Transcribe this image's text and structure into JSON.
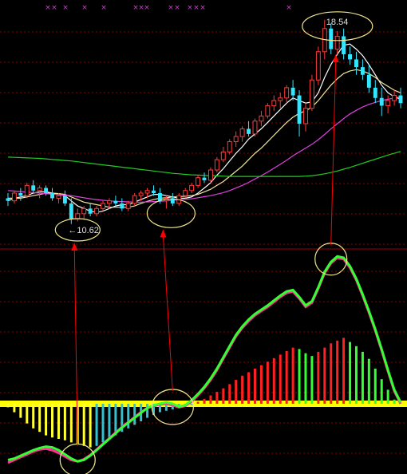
{
  "colors": {
    "background": "#000000",
    "grid": "#8b0000",
    "separator": "#a00000",
    "candle_up": "#ff3b3b",
    "candle_down": "#33e6ff",
    "ma_short": "#ffffff",
    "ma_mid": "#f2e6a0",
    "ma_long": "#e040e0",
    "ma_longest": "#22cc22",
    "macd_pos": "#ff2020",
    "macd_pos_green": "#33ff33",
    "macd_neg_yellow": "#ffff33",
    "macd_neg_cyan": "#33c0d0",
    "zero_band": "#ffff00",
    "dif_line": "#33ff33",
    "dea_line": "#ff3399",
    "circle": "#f0e68c",
    "arrow": "#ff0000",
    "marker_x": "#d040d0"
  },
  "chart_data": [
    {
      "type": "candlestick",
      "annotations": {
        "low_label": "←10.62",
        "high_label": "18.54"
      },
      "grid": true,
      "candles": [
        [
          11.6,
          11.8,
          11.3,
          11.5
        ],
        [
          11.5,
          11.9,
          11.4,
          11.8
        ],
        [
          11.8,
          12.0,
          11.5,
          11.7
        ],
        [
          11.7,
          12.2,
          11.6,
          12.1
        ],
        [
          12.1,
          12.3,
          11.8,
          11.9
        ],
        [
          11.9,
          12.1,
          11.6,
          12.0
        ],
        [
          12.0,
          12.1,
          11.7,
          11.8
        ],
        [
          11.8,
          12.0,
          11.5,
          11.6
        ],
        [
          11.6,
          11.8,
          11.4,
          11.7
        ],
        [
          11.7,
          11.9,
          11.3,
          11.4
        ],
        [
          11.4,
          11.6,
          10.6,
          10.8
        ],
        [
          10.8,
          11.2,
          10.7,
          11.0
        ],
        [
          11.0,
          11.3,
          10.8,
          11.2
        ],
        [
          11.2,
          11.4,
          10.9,
          11.0
        ],
        [
          11.0,
          11.3,
          10.9,
          11.2
        ],
        [
          11.2,
          11.5,
          11.1,
          11.4
        ],
        [
          11.4,
          11.6,
          11.2,
          11.5
        ],
        [
          11.5,
          11.7,
          11.3,
          11.4
        ],
        [
          11.4,
          11.6,
          11.1,
          11.2
        ],
        [
          11.2,
          11.5,
          11.1,
          11.4
        ],
        [
          11.4,
          11.8,
          11.3,
          11.7
        ],
        [
          11.7,
          11.9,
          11.5,
          11.8
        ],
        [
          11.8,
          12.0,
          11.6,
          11.9
        ],
        [
          11.9,
          12.1,
          11.7,
          11.8
        ],
        [
          11.8,
          12.0,
          11.4,
          11.5
        ],
        [
          11.5,
          11.7,
          11.2,
          11.6
        ],
        [
          11.6,
          11.8,
          11.3,
          11.4
        ],
        [
          11.4,
          11.8,
          11.3,
          11.7
        ],
        [
          11.7,
          12.0,
          11.6,
          11.9
        ],
        [
          11.9,
          12.2,
          11.8,
          12.1
        ],
        [
          12.1,
          12.5,
          12.0,
          12.4
        ],
        [
          12.4,
          12.6,
          12.2,
          12.3
        ],
        [
          12.3,
          12.8,
          12.2,
          12.7
        ],
        [
          12.7,
          13.2,
          12.6,
          13.1
        ],
        [
          13.1,
          13.6,
          13.0,
          13.4
        ],
        [
          13.4,
          13.9,
          13.3,
          13.8
        ],
        [
          13.8,
          14.2,
          13.6,
          14.0
        ],
        [
          14.0,
          14.4,
          13.8,
          14.3
        ],
        [
          14.3,
          14.6,
          14.0,
          14.1
        ],
        [
          14.1,
          14.7,
          14.0,
          14.6
        ],
        [
          14.6,
          15.0,
          14.4,
          14.8
        ],
        [
          14.8,
          15.3,
          14.7,
          15.2
        ],
        [
          15.2,
          15.6,
          15.0,
          15.4
        ],
        [
          15.4,
          15.7,
          15.1,
          15.5
        ],
        [
          15.5,
          16.0,
          15.3,
          15.9
        ],
        [
          15.9,
          16.2,
          15.4,
          15.6
        ],
        [
          15.6,
          15.8,
          14.0,
          14.5
        ],
        [
          14.5,
          15.3,
          14.2,
          15.1
        ],
        [
          15.1,
          16.4,
          15.0,
          16.2
        ],
        [
          16.2,
          17.5,
          16.0,
          17.3
        ],
        [
          17.3,
          18.54,
          17.0,
          18.2
        ],
        [
          18.2,
          18.4,
          17.2,
          17.4
        ],
        [
          17.4,
          18.1,
          17.2,
          17.9
        ],
        [
          17.9,
          18.2,
          17.0,
          17.2
        ],
        [
          17.2,
          17.5,
          16.8,
          17.0
        ],
        [
          17.0,
          17.3,
          16.4,
          16.7
        ],
        [
          16.7,
          17.0,
          16.2,
          16.4
        ],
        [
          16.4,
          16.8,
          15.7,
          15.9
        ],
        [
          15.9,
          16.2,
          15.3,
          15.5
        ],
        [
          15.5,
          15.9,
          14.8,
          15.2
        ],
        [
          15.2,
          15.6,
          14.9,
          15.4
        ],
        [
          15.4,
          15.8,
          15.2,
          15.6
        ],
        [
          15.6,
          15.9,
          15.1,
          15.3
        ]
      ],
      "ylim": [
        10.0,
        19.0
      ],
      "series": [
        {
          "name": "MA5",
          "values": [
            11.5,
            11.6,
            11.65,
            11.7,
            11.8,
            11.85,
            11.85,
            11.8,
            11.75,
            11.7,
            11.5,
            11.3,
            11.2,
            11.1,
            11.05,
            11.1,
            11.2,
            11.3,
            11.35,
            11.35,
            11.45,
            11.55,
            11.65,
            11.75,
            11.75,
            11.7,
            11.65,
            11.6,
            11.6,
            11.65,
            11.8,
            12.0,
            12.2,
            12.5,
            12.75,
            13.05,
            13.35,
            13.6,
            13.9,
            14.1,
            14.3,
            14.55,
            14.8,
            15.05,
            15.3,
            15.5,
            15.4,
            15.3,
            15.35,
            15.7,
            16.3,
            16.8,
            17.2,
            17.55,
            17.6,
            17.4,
            17.15,
            16.8,
            16.4,
            16.0,
            15.7,
            15.55,
            15.45
          ]
        },
        {
          "name": "MA10",
          "values": [
            11.6,
            11.6,
            11.6,
            11.65,
            11.7,
            11.75,
            11.8,
            11.8,
            11.78,
            11.75,
            11.65,
            11.55,
            11.45,
            11.4,
            11.35,
            11.3,
            11.25,
            11.25,
            11.25,
            11.25,
            11.3,
            11.4,
            11.48,
            11.55,
            11.6,
            11.62,
            11.65,
            11.66,
            11.68,
            11.7,
            11.75,
            11.85,
            11.95,
            12.1,
            12.25,
            12.45,
            12.65,
            12.85,
            13.1,
            13.35,
            13.55,
            13.8,
            14.05,
            14.3,
            14.55,
            14.75,
            14.9,
            15.0,
            15.15,
            15.4,
            15.7,
            16.0,
            16.25,
            16.45,
            16.55,
            16.6,
            16.55,
            16.45,
            16.3,
            16.1,
            15.95,
            15.8,
            15.7
          ]
        },
        {
          "name": "MA30",
          "values": [
            11.9,
            11.88,
            11.86,
            11.84,
            11.82,
            11.8,
            11.78,
            11.76,
            11.74,
            11.72,
            11.7,
            11.66,
            11.62,
            11.58,
            11.55,
            11.52,
            11.5,
            11.48,
            11.47,
            11.46,
            11.45,
            11.45,
            11.46,
            11.47,
            11.48,
            11.5,
            11.52,
            11.54,
            11.56,
            11.58,
            11.62,
            11.66,
            11.7,
            11.76,
            11.82,
            11.9,
            12.0,
            12.1,
            12.22,
            12.35,
            12.48,
            12.62,
            12.77,
            12.92,
            13.08,
            13.25,
            13.4,
            13.55,
            13.7,
            13.88,
            14.08,
            14.3,
            14.5,
            14.7,
            14.88,
            15.02,
            15.15,
            15.25,
            15.33,
            15.4,
            15.45,
            15.5,
            15.55
          ]
        },
        {
          "name": "MA60",
          "values": [
            13.2,
            13.19,
            13.18,
            13.17,
            13.16,
            13.15,
            13.13,
            13.11,
            13.09,
            13.07,
            13.05,
            13.02,
            12.99,
            12.96,
            12.93,
            12.9,
            12.87,
            12.84,
            12.81,
            12.78,
            12.75,
            12.72,
            12.69,
            12.66,
            12.63,
            12.6,
            12.57,
            12.55,
            12.53,
            12.51,
            12.5,
            12.49,
            12.48,
            12.47,
            12.46,
            12.45,
            12.45,
            12.45,
            12.45,
            12.45,
            12.45,
            12.45,
            12.45,
            12.45,
            12.45,
            12.45,
            12.45,
            12.46,
            12.48,
            12.51,
            12.55,
            12.6,
            12.66,
            12.73,
            12.8,
            12.88,
            12.96,
            13.04,
            13.12,
            13.2,
            13.28,
            13.35,
            13.42
          ]
        }
      ]
    },
    {
      "type": "bar",
      "ylim": [
        -1.0,
        2.0
      ],
      "zero_line": true,
      "histogram": [
        -0.05,
        -0.12,
        -0.2,
        -0.28,
        -0.35,
        -0.4,
        -0.45,
        -0.48,
        -0.5,
        -0.52,
        -0.55,
        -0.58,
        -0.6,
        -0.62,
        -0.6,
        -0.55,
        -0.5,
        -0.45,
        -0.4,
        -0.35,
        -0.3,
        -0.25,
        -0.2,
        -0.16,
        -0.12,
        -0.1,
        -0.08,
        -0.06,
        -0.04,
        -0.02,
        0.03,
        0.07,
        0.12,
        0.17,
        0.22,
        0.28,
        0.34,
        0.4,
        0.45,
        0.5,
        0.55,
        0.6,
        0.65,
        0.7,
        0.75,
        0.8,
        0.78,
        0.72,
        0.68,
        0.74,
        0.8,
        0.86,
        0.9,
        0.94,
        0.88,
        0.82,
        0.74,
        0.64,
        0.5,
        0.35,
        0.2,
        0.06,
        -0.02
      ],
      "series": [
        {
          "name": "DIF",
          "values": [
            -0.8,
            -0.78,
            -0.74,
            -0.7,
            -0.66,
            -0.63,
            -0.61,
            -0.62,
            -0.66,
            -0.72,
            -0.78,
            -0.82,
            -0.8,
            -0.74,
            -0.66,
            -0.58,
            -0.5,
            -0.42,
            -0.34,
            -0.27,
            -0.2,
            -0.13,
            -0.06,
            -0.02,
            0.0,
            0.02,
            0.0,
            -0.04,
            -0.02,
            0.05,
            0.14,
            0.24,
            0.36,
            0.5,
            0.66,
            0.82,
            0.98,
            1.1,
            1.2,
            1.28,
            1.34,
            1.4,
            1.47,
            1.54,
            1.6,
            1.62,
            1.52,
            1.4,
            1.46,
            1.66,
            1.88,
            2.02,
            2.1,
            2.08,
            1.96,
            1.78,
            1.56,
            1.32,
            1.06,
            0.78,
            0.48,
            0.2,
            0.02
          ]
        },
        {
          "name": "DEA",
          "values": [
            -0.84,
            -0.8,
            -0.76,
            -0.72,
            -0.68,
            -0.65,
            -0.64,
            -0.66,
            -0.7,
            -0.75,
            -0.8,
            -0.82,
            -0.79,
            -0.73,
            -0.65,
            -0.57,
            -0.49,
            -0.41,
            -0.33,
            -0.26,
            -0.19,
            -0.12,
            -0.06,
            -0.03,
            -0.01,
            0.0,
            -0.02,
            -0.05,
            -0.03,
            0.03,
            0.12,
            0.22,
            0.34,
            0.48,
            0.64,
            0.8,
            0.96,
            1.08,
            1.18,
            1.26,
            1.32,
            1.38,
            1.45,
            1.52,
            1.58,
            1.6,
            1.5,
            1.38,
            1.44,
            1.64,
            1.86,
            2.0,
            2.08,
            2.06,
            1.94,
            1.76,
            1.54,
            1.3,
            1.04,
            0.76,
            0.46,
            0.18,
            0.0
          ]
        }
      ]
    }
  ]
}
